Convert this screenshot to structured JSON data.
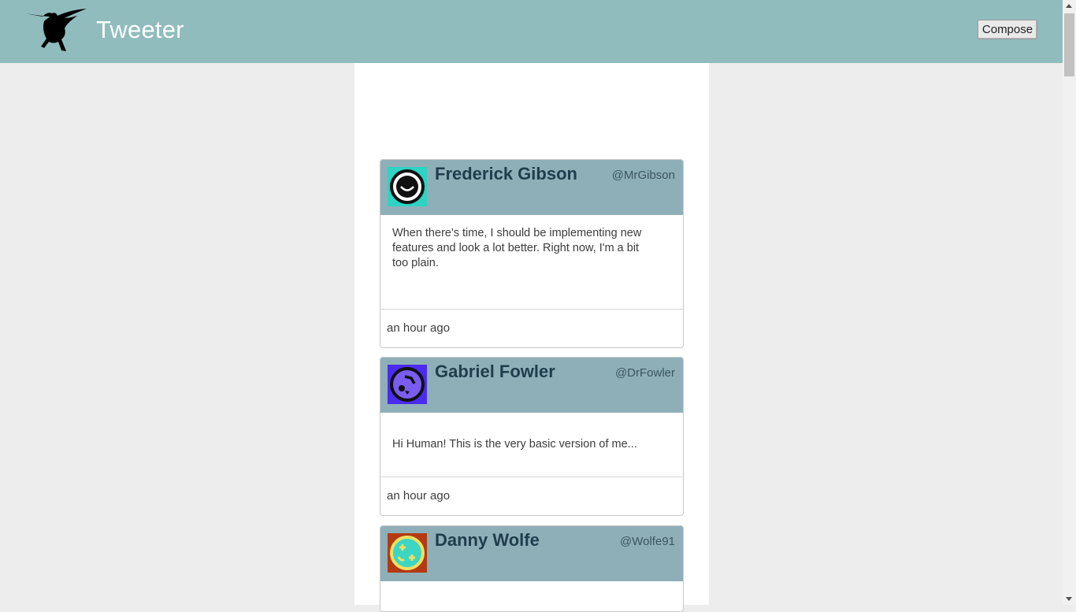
{
  "nav": {
    "brand": "Tweeter",
    "compose_label": "Compose",
    "logo_icon": "hummingbird-icon"
  },
  "tweets": [
    {
      "name": "Frederick Gibson",
      "handle": "@MrGibson",
      "text": "When there's time, I should be implementing new features and look a lot better. Right now, I'm a bit too plain.",
      "time": "an hour ago",
      "avatar_icon": "smiley-face-icon",
      "avatar_bg": "#2dd4c4"
    },
    {
      "name": "Gabriel Fowler",
      "handle": "@DrFowler",
      "text": "Hi Human! This is the very basic version of me...",
      "time": "an hour ago",
      "avatar_icon": "abstract-face-icon",
      "avatar_bg": "#4b2bf0"
    },
    {
      "name": "Danny Wolfe",
      "handle": "@Wolfe91",
      "avatar_icon": "plus-face-icon",
      "avatar_bg": "#b33a12"
    }
  ],
  "colors": {
    "navbar": "#90bcbe",
    "tweet_header": "#8fafb8",
    "name_text": "#1f3d4d"
  }
}
